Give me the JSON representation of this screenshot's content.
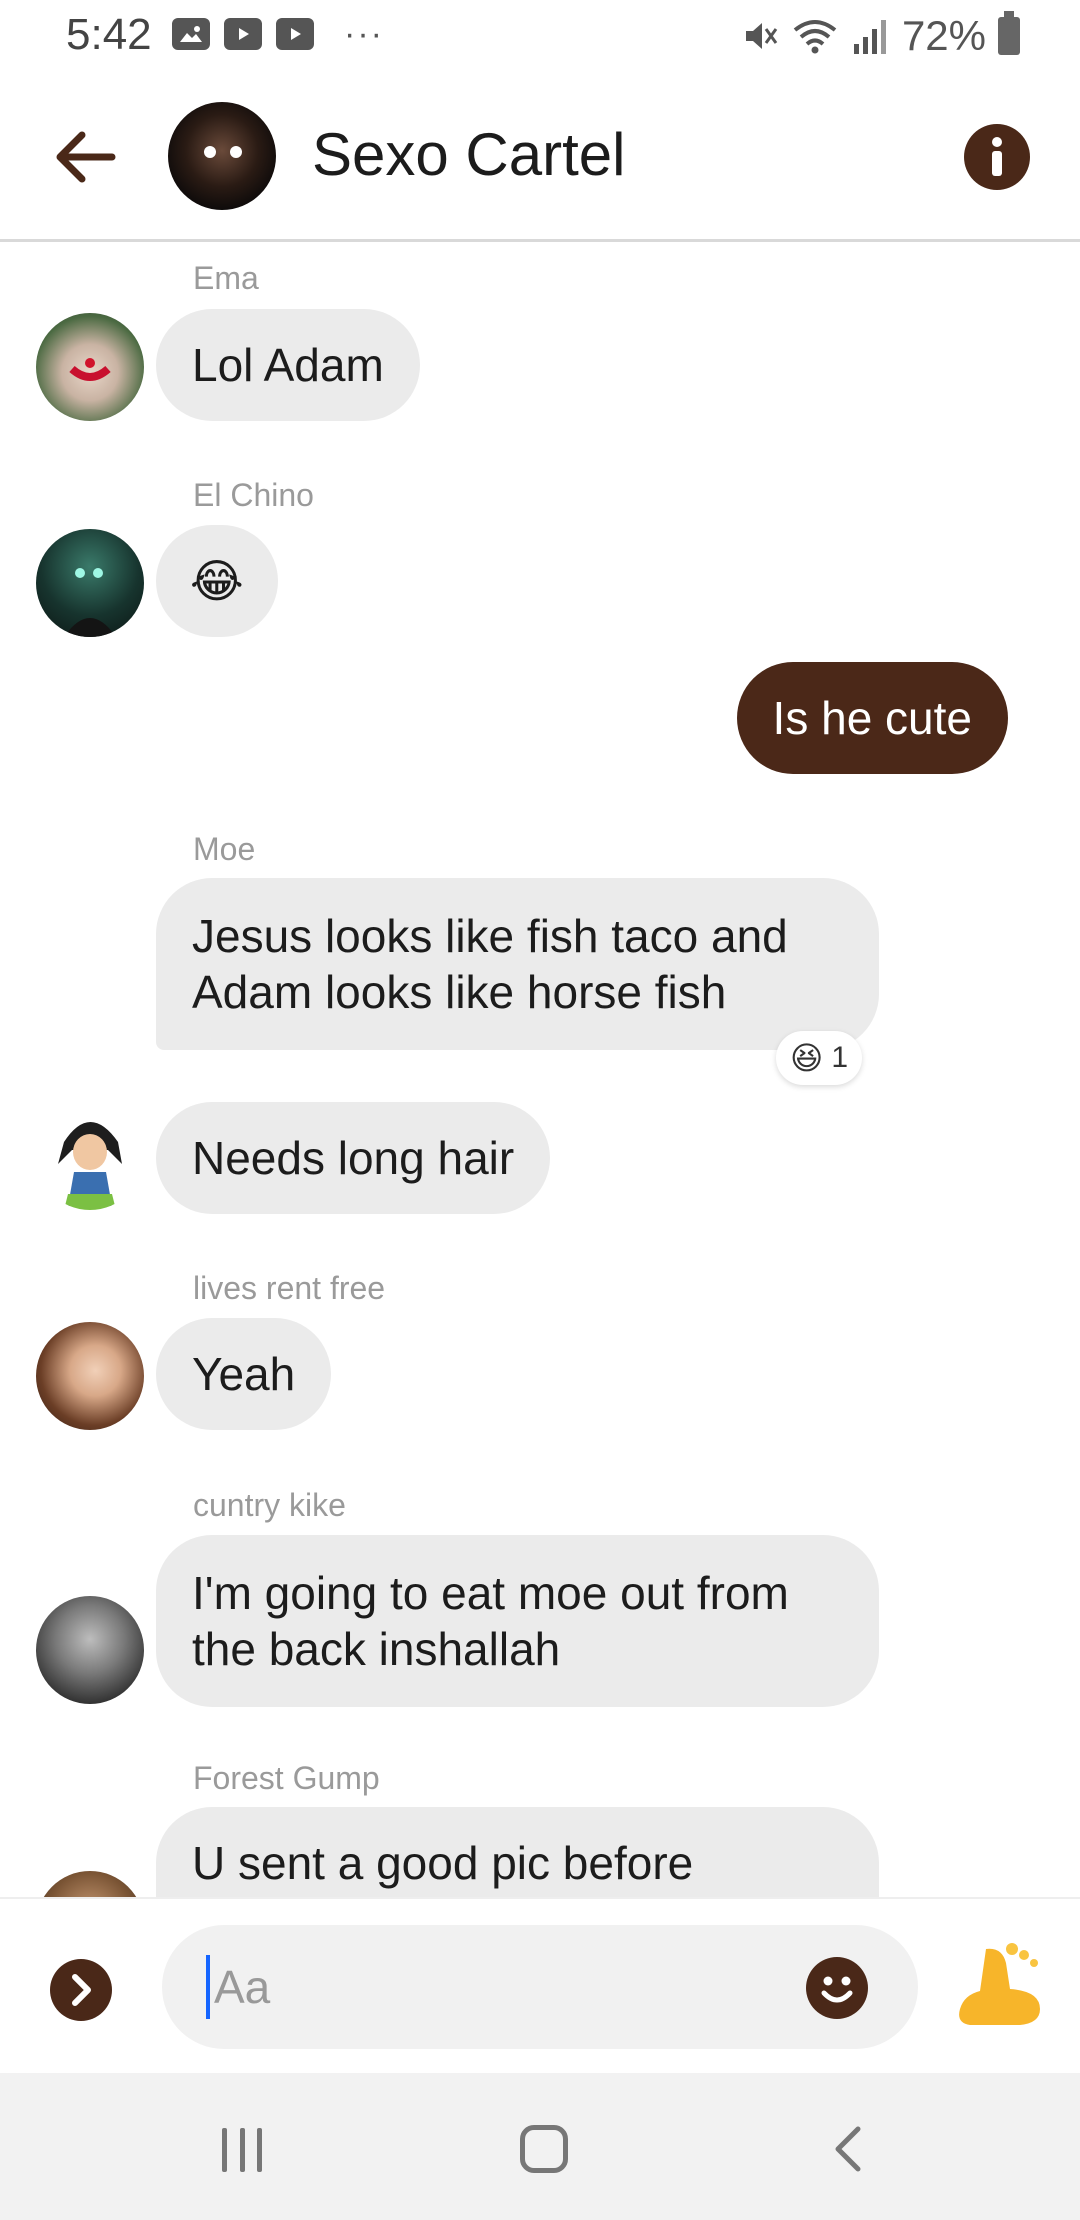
{
  "status_bar": {
    "time": "5:42",
    "more": "···",
    "battery_percent": "72%"
  },
  "header": {
    "title": "Sexo Cartel"
  },
  "messages": [
    {
      "sender": "Ema",
      "text": "Lol Adam"
    },
    {
      "sender": "El Chino",
      "emoji": "😂"
    },
    {
      "outgoing": true,
      "text": "Is he cute"
    },
    {
      "sender": "Moe",
      "text_lines": [
        "Jesus looks like fish taco and",
        "Adam looks like horse fish"
      ],
      "reaction": {
        "emoji": "😆",
        "count": "1"
      }
    },
    {
      "sender": "",
      "text": "Needs long hair"
    },
    {
      "sender": "lives rent free",
      "text": "Yeah"
    },
    {
      "sender": "cuntry kike",
      "text_lines": [
        "I'm going to eat moe out from",
        "the back inshallah"
      ]
    },
    {
      "sender": "Forest Gump",
      "text": "U sent a good pic before"
    }
  ],
  "composer": {
    "placeholder": "Aa"
  },
  "colors": {
    "accent": "#4a2818",
    "incoming_bubble": "#ebebeb",
    "outgoing_bubble": "#4b2818"
  }
}
